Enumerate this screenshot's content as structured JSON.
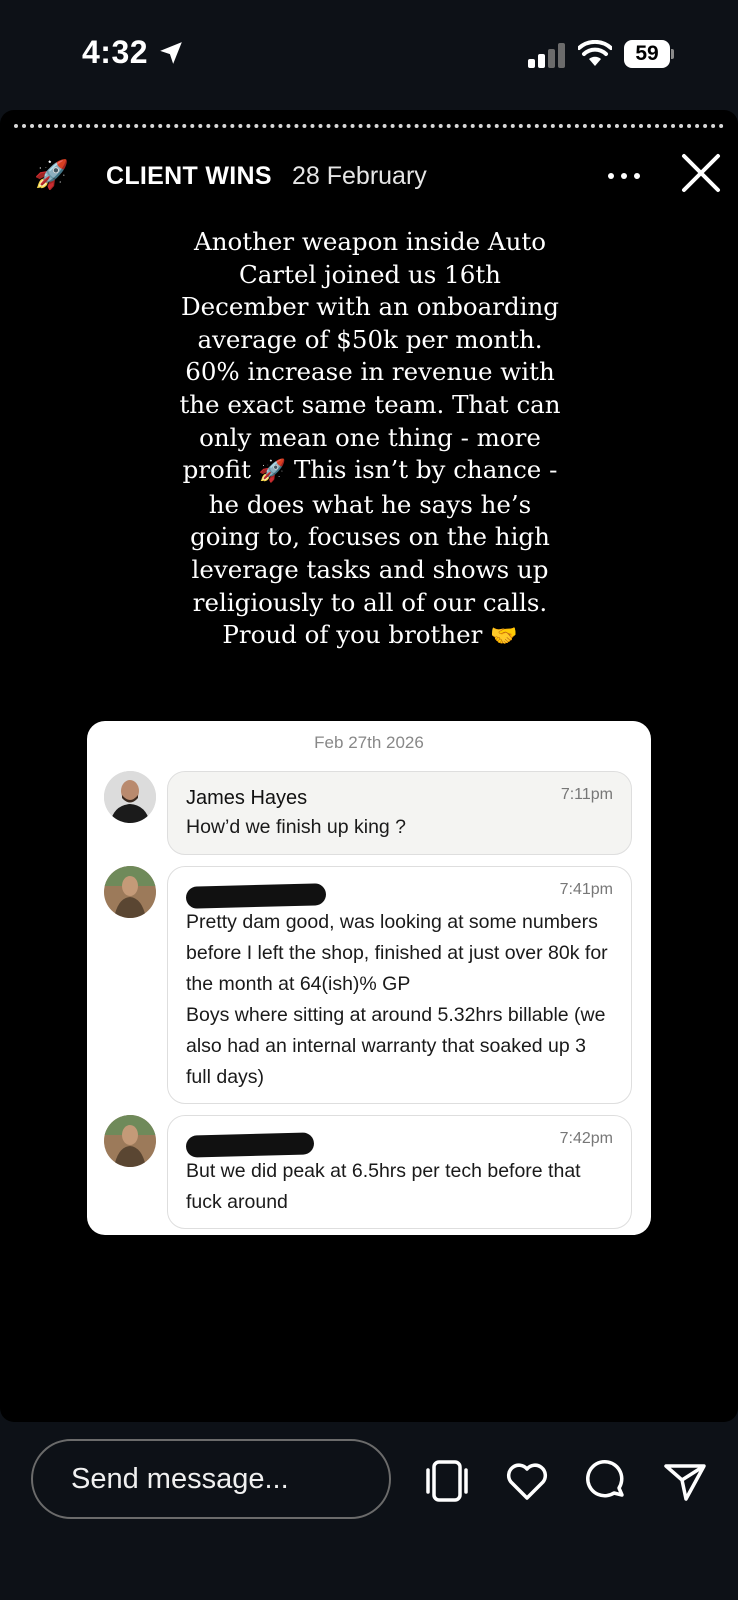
{
  "status_bar": {
    "time": "4:32",
    "battery": "59"
  },
  "story": {
    "author": "CLIENT WINS",
    "date": "28 February",
    "caption": "Another weapon inside Auto Cartel joined us 16th December with an onboarding average of $50k per month. 60% increase in revenue with the exact same team. That can only mean one thing - more profit",
    "caption_emoji_1": "🚀",
    "caption_2": "This isn’t by chance - he does what he says he’s going to, focuses on the high leverage tasks and shows up religiously to all of our calls. Proud of you brother",
    "caption_emoji_2": "🤝"
  },
  "chat": {
    "date": "Feb 27th 2026",
    "messages": [
      {
        "sender": "James Hayes",
        "time": "7:11pm",
        "text": "How’d we finish up king ?"
      },
      {
        "sender": "",
        "time": "7:41pm",
        "text": "Pretty dam good, was looking at some numbers before I left the shop, finished at just over 80k for the month at 64(ish)% GP\nBoys where sitting at around 5.32hrs billable (we also had an internal warranty that soaked up 3 full days)"
      },
      {
        "sender": "",
        "time": "7:42pm",
        "text": "But we did peak at 6.5hrs per tech before that fuck around"
      }
    ]
  },
  "composer": {
    "placeholder": "Send message..."
  },
  "icons": {
    "header": "rocket-icon",
    "actions": [
      "reels-icon",
      "heart-icon",
      "comment-icon",
      "share-icon"
    ]
  }
}
